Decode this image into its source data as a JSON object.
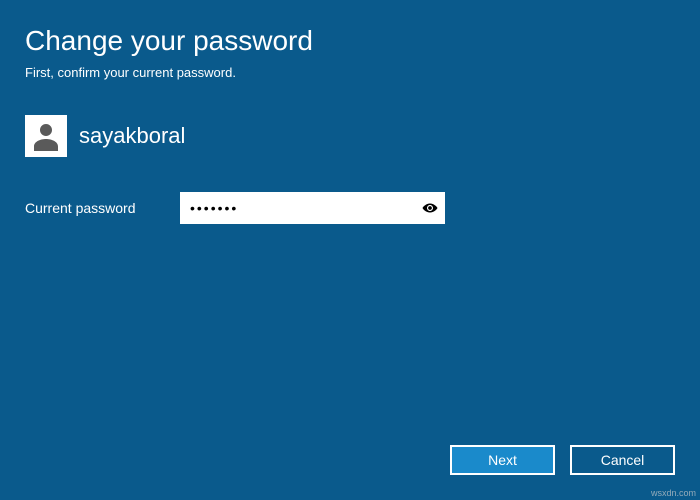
{
  "header": {
    "title": "Change your password",
    "subtitle": "First, confirm your current password."
  },
  "user": {
    "name": "sayakboral"
  },
  "form": {
    "current_password_label": "Current password",
    "current_password_value": "•••••••"
  },
  "buttons": {
    "next": "Next",
    "cancel": "Cancel"
  },
  "watermark": "wsxdn.com"
}
